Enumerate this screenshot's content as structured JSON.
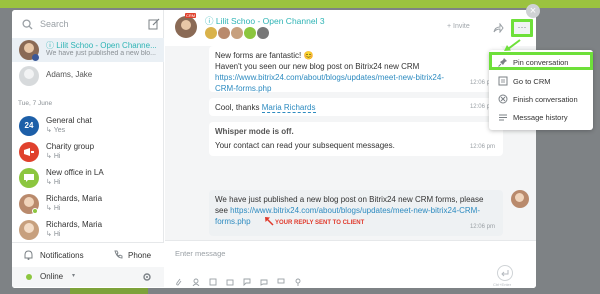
{
  "sidebar": {
    "search_placeholder": "Search",
    "items": [
      {
        "name": "Lilit Schoo - Open Channe...",
        "sub": "We have just published a new blo..."
      },
      {
        "name": "Adams, Jake",
        "sub": ""
      },
      {
        "name": "General chat",
        "sub": "Yes"
      },
      {
        "name": "Charity group",
        "sub": "Hi"
      },
      {
        "name": "New office in LA",
        "sub": "Hi"
      },
      {
        "name": "Richards, Maria",
        "sub": "Hi"
      },
      {
        "name": "Richards, Maria",
        "sub": "Hi"
      }
    ],
    "date_divider": "Tue, 7 June",
    "general_chat_avatar": "24",
    "notifications_label": "Notifications",
    "phone_label": "Phone",
    "online_label": "Online",
    "online_caret": "▾"
  },
  "header": {
    "title": "Lilit Schoo - Open Channel 3",
    "invite_label": "+ Invite",
    "more_label": "···",
    "close_label": "×"
  },
  "messages": {
    "m1_line1": "New forms are fantastic! 😊",
    "m1_line2": "Haven't you seen our new blog post on Bitrix24 new CRM",
    "m1_link": "https://www.bitrix24.com/about/blogs/updates/meet-new-bitrix24-CRM-forms.php",
    "m1_time": "12:06 pm",
    "m2_text": "Cool, thanks ",
    "m2_mention": "Maria Richards",
    "m2_time": "12:06 pm",
    "m3_title": "Whisper mode is off.",
    "m3_text": "Your contact can read your subsequent messages.",
    "m3_time": "12:06 pm",
    "m4_line1": "We have just published a new blog post on Bitrix24 new CRM forms, please",
    "m4_prefix": "see ",
    "m4_link": "https://www.bitrix24.com/about/blogs/updates/meet-new-bitrix24-CRM-forms.php",
    "m4_time": "12:06 pm",
    "annotation": "YOUR REPLY SENT TO CLIENT"
  },
  "input": {
    "placeholder": "Enter message",
    "send_hint": "Ctrl+Enter"
  },
  "dropdown": {
    "items": [
      {
        "label": "Pin conversation",
        "icon": "pin-icon"
      },
      {
        "label": "Go to CRM",
        "icon": "crm-icon"
      },
      {
        "label": "Finish conversation",
        "icon": "finish-icon"
      },
      {
        "label": "Message history",
        "icon": "history-icon"
      }
    ]
  },
  "colors": {
    "accent_teal": "#2fb4b5",
    "highlight_green": "#6ee03a",
    "link_blue": "#2d8bc0",
    "annotation_red": "#e03a2c"
  }
}
